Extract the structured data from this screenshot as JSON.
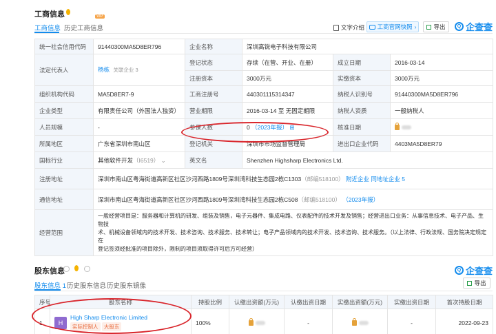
{
  "business": {
    "title": "工商信息",
    "tabs": [
      "工商信息",
      "历史工商信息"
    ],
    "vip_badge": "VIP",
    "toolbar": {
      "text_intro": "文字介绍",
      "express": "工商官网快照",
      "export": "导出"
    },
    "brand": "企查查",
    "rows": {
      "credit_code_label": "统一社会信用代码",
      "credit_code": "91440300MA5D8ER796",
      "company_name_label": "企业名称",
      "company_name": "深圳高锐电子科技有限公司",
      "legal_rep_label": "法定代表人",
      "legal_rep": "杨栋",
      "legal_rep_tag": "关联企业 3",
      "reg_status_label": "登记状态",
      "reg_status": "存续（在营、开业、在册）",
      "est_date_label": "成立日期",
      "est_date": "2016-03-14",
      "reg_capital_label": "注册资本",
      "reg_capital": "3000万元",
      "paid_capital_label": "实缴资本",
      "paid_capital": "3000万元",
      "org_code_label": "组织机构代码",
      "org_code": "MA5D8ER7-9",
      "reg_no_label": "工商注册号",
      "reg_no": "440301115314347",
      "taxpayer_id_label": "纳税人识别号",
      "taxpayer_id": "91440300MA5D8ER796",
      "company_type_label": "企业类型",
      "company_type": "有限责任公司（外国法人独资）",
      "biz_term_label": "营业期限",
      "biz_term": "2016-03-14 至 无固定期限",
      "taxpayer_qual_label": "纳税人资质",
      "taxpayer_qual": "一般纳税人",
      "staff_size_label": "人员规模",
      "staff_size": "-",
      "insured_label": "参保人数",
      "insured": "0",
      "insured_year": "（2023年报）",
      "check_date_label": "核准日期",
      "region_label": "所属地区",
      "region": "广东省深圳市南山区",
      "reg_authority_label": "登记机关",
      "reg_authority": "深圳市市场监督管理局",
      "import_code_label": "进出口企业代码",
      "import_code": "4403MA5D8ER79",
      "industry_label": "国标行业",
      "industry": "其他软件开发",
      "industry_code": "（I6519）",
      "en_name_label": "英文名",
      "en_name": "Shenzhen Highsharp Electronics Ltd.",
      "reg_addr_label": "注册地址",
      "reg_addr": "深圳市南山区粤海街道高新区社区沙河西路1809号深圳湾科技生态园2栋C1303",
      "reg_addr_zip": "（邮编518100）",
      "nearby": "附近企业",
      "more_addr": "同地址企业 5",
      "mail_addr_label": "通信地址",
      "mail_addr": "深圳市南山区粤海街道高新区社区沙河西路1809号深圳湾科技生态园2栋C508",
      "mail_addr_zip": "（邮编518100）",
      "mail_addr_year": "（2023年报）",
      "scope_label": "经营范围",
      "scope_lines": [
        "一般经营项目是：服务器和计算机的研发、组装及销售，电子元器件、集成电路、仪表配件的技术开发及销售；经营进出口业务：从事信息技术、电子产品、生物技",
        "术、机械设备领域内的技术开发、技术咨询、技术服务、技术转让；电子产品领域内的技术开发、技术咨询、技术服务。（以上法律、行政法规、国务院决定规定在",
        "登记签须经批准的项目除外，限制的项目须取得许可后方可经营）"
      ]
    }
  },
  "shareholders": {
    "title": "股东信息",
    "tabs": [
      "股东信息 1",
      "历史股东信息",
      "历史股东镜像"
    ],
    "export": "导出",
    "brand": "企查查",
    "headers": [
      "序号",
      "股东名称",
      "持股比例",
      "认缴出资额(万元)",
      "认缴出资日期",
      "实缴出资额(万元)",
      "实缴出资日期",
      "首次持股日期"
    ],
    "rows": [
      {
        "no": "1",
        "avatar": "H",
        "name": "High Sharp Electronic Limited",
        "tag1": "实际控制人",
        "tag2": "大股东",
        "ratio": "100%",
        "sub_date": "-",
        "paid_date": "-",
        "first_date": "2022-09-23"
      }
    ]
  }
}
